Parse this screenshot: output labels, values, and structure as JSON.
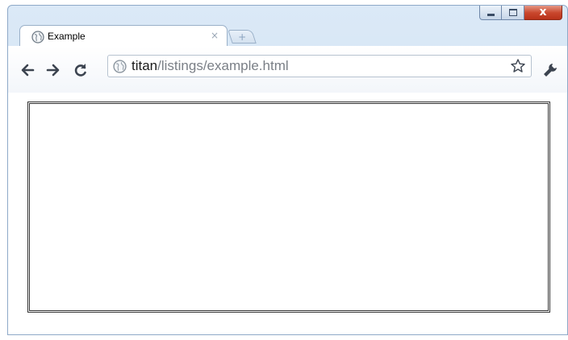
{
  "window": {
    "controls": [
      "minimize",
      "maximize",
      "close"
    ],
    "close_glyph": "x"
  },
  "tab": {
    "title": "Example",
    "close_glyph": "×",
    "icon": "globe-icon"
  },
  "new_tab": {
    "glyph": "+"
  },
  "toolbar": {
    "back_icon": "back-arrow-icon",
    "forward_icon": "forward-arrow-icon",
    "reload_icon": "reload-icon",
    "address": {
      "host": "titan",
      "path": "/listings/example.html",
      "icon": "globe-icon"
    },
    "bookmark_icon": "star-icon",
    "settings_icon": "wrench-icon"
  },
  "colors": {
    "frame": "#c9dcef",
    "close_button": "#c9472d",
    "url_path": "#7a7f86"
  }
}
